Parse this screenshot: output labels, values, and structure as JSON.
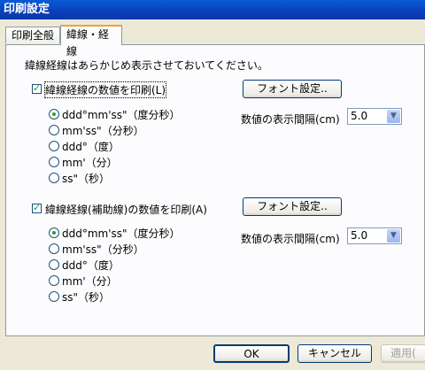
{
  "window": {
    "title": "印刷設定"
  },
  "tabs": [
    {
      "label": "印刷全般"
    },
    {
      "label": "緯線・経線"
    }
  ],
  "description": "緯線経線はあらかじめ表示させておいてください。",
  "section1": {
    "checkbox_label": "緯線経線の数値を印刷(L)",
    "checked": true,
    "font_button": "フォント設定..",
    "interval_label": "数値の表示間隔(cm)",
    "interval_value": "5.0",
    "formats": [
      {
        "label": "ddd°mm'ss\"（度分秒）",
        "selected": true
      },
      {
        "label": "mm'ss\"（分秒）",
        "selected": false
      },
      {
        "label": "ddd°（度）",
        "selected": false
      },
      {
        "label": "mm'（分）",
        "selected": false
      },
      {
        "label": "ss\"（秒）",
        "selected": false
      }
    ]
  },
  "section2": {
    "checkbox_label": "緯線経線(補助線)の数値を印刷(A)",
    "checked": true,
    "font_button": "フォント設定..",
    "interval_label": "数値の表示間隔(cm)",
    "interval_value": "5.0",
    "formats": [
      {
        "label": "ddd°mm'ss\"（度分秒）",
        "selected": true
      },
      {
        "label": "mm'ss\"（分秒）",
        "selected": false
      },
      {
        "label": "ddd°（度）",
        "selected": false
      },
      {
        "label": "mm'（分）",
        "selected": false
      },
      {
        "label": "ss\"（秒）",
        "selected": false
      }
    ]
  },
  "footer": {
    "ok": "OK",
    "cancel": "キャンセル",
    "apply": "適用("
  }
}
